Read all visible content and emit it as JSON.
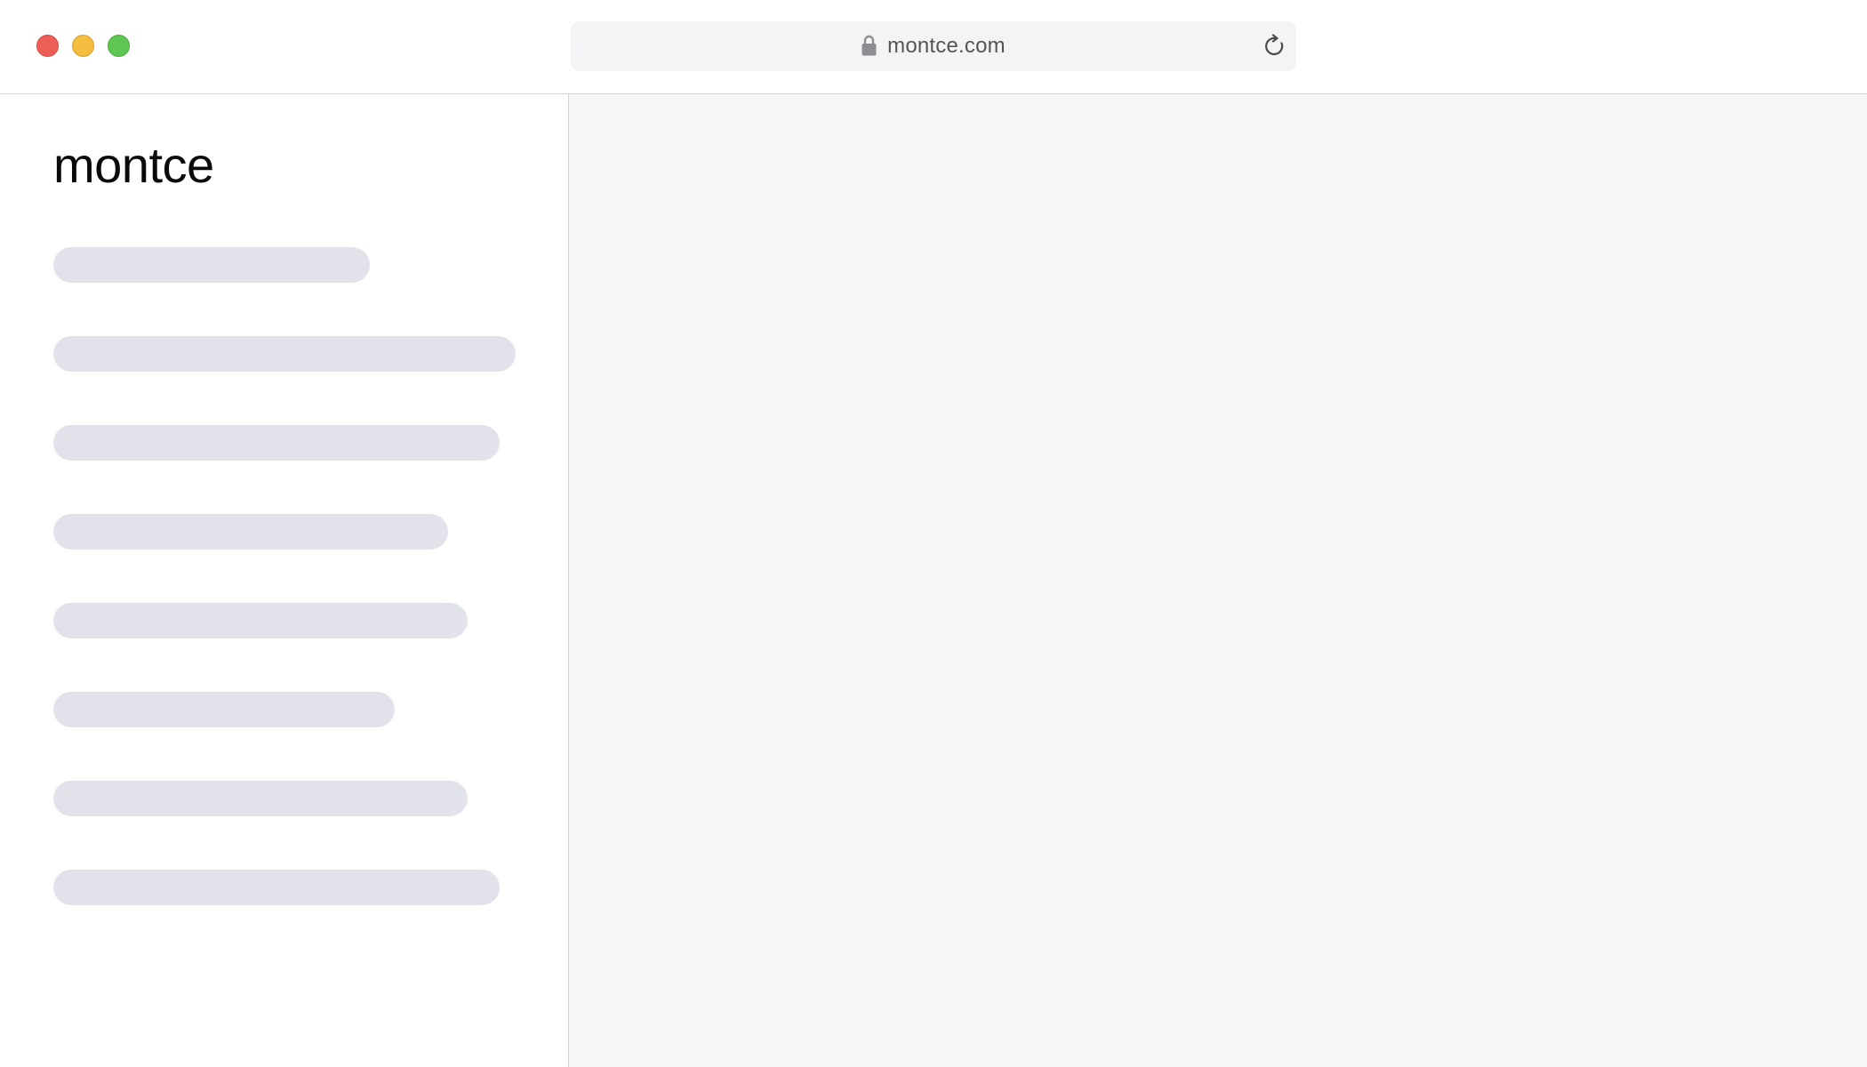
{
  "browser": {
    "url": "montce.com",
    "window_controls": [
      "close",
      "minimize",
      "zoom"
    ],
    "icons": {
      "lock": "lock-icon",
      "reload": "reload-icon"
    }
  },
  "sidebar": {
    "brand": "montce",
    "loading_placeholders": 8
  },
  "colors": {
    "close": "#ec5f57",
    "minimize": "#f3bd3f",
    "zoom": "#5fc553",
    "address_bar": "#f4f4f6",
    "skeleton": "#e2e2ea",
    "content_bg": "#f6f6f8"
  }
}
